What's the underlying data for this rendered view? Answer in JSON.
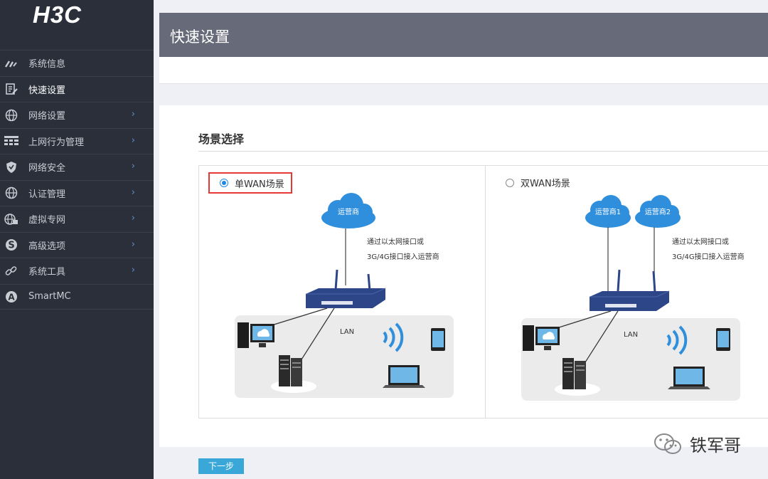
{
  "brand": {
    "logo": "H3C"
  },
  "sidebar": {
    "items": [
      {
        "label": "系统信息",
        "icon": "speedometer-icon",
        "chevron": false,
        "active": false
      },
      {
        "label": "快速设置",
        "icon": "document-edit-icon",
        "chevron": false,
        "active": true
      },
      {
        "label": "网络设置",
        "icon": "globe-icon",
        "chevron": true,
        "active": false
      },
      {
        "label": "上网行为管理",
        "icon": "bars-icon",
        "chevron": true,
        "active": false
      },
      {
        "label": "网络安全",
        "icon": "shield-icon",
        "chevron": true,
        "active": false
      },
      {
        "label": "认证管理",
        "icon": "globe-icon",
        "chevron": true,
        "active": false
      },
      {
        "label": "虚拟专网",
        "icon": "globe-lock-icon",
        "chevron": true,
        "active": false
      },
      {
        "label": "高级选项",
        "icon": "s-circle-icon",
        "chevron": true,
        "active": false
      },
      {
        "label": "系统工具",
        "icon": "link-icon",
        "chevron": true,
        "active": false
      },
      {
        "label": "SmartMC",
        "icon": "a-circle-icon",
        "chevron": false,
        "active": false
      }
    ],
    "chevron_glyph": "›"
  },
  "header": {
    "title": "快速设置"
  },
  "scene": {
    "title": "场景选择",
    "options": [
      {
        "label": "单WAN场景",
        "selected": true
      },
      {
        "label": "双WAN场景",
        "selected": false
      }
    ],
    "single": {
      "cloud_label": "运营商",
      "note_line1": "通过以太网接口或",
      "note_line2": "3G/4G接口接入运营商",
      "lan_label": "LAN"
    },
    "dual": {
      "cloud1_label": "运营商1",
      "cloud2_label": "运营商2",
      "note_line1": "通过以太网接口或",
      "note_line2": "3G/4G接口接入运营商",
      "lan_label": "LAN"
    }
  },
  "actions": {
    "next_label": "下一步"
  },
  "watermark": {
    "text": "铁军哥"
  },
  "colors": {
    "sidebar_bg": "#2b2f3a",
    "header_bg": "#676a78",
    "accent": "#3aa7d9",
    "radio": "#1e88e5",
    "highlight_border": "#e53935",
    "cloud": "#2f8fdc",
    "router": "#2d4688"
  }
}
